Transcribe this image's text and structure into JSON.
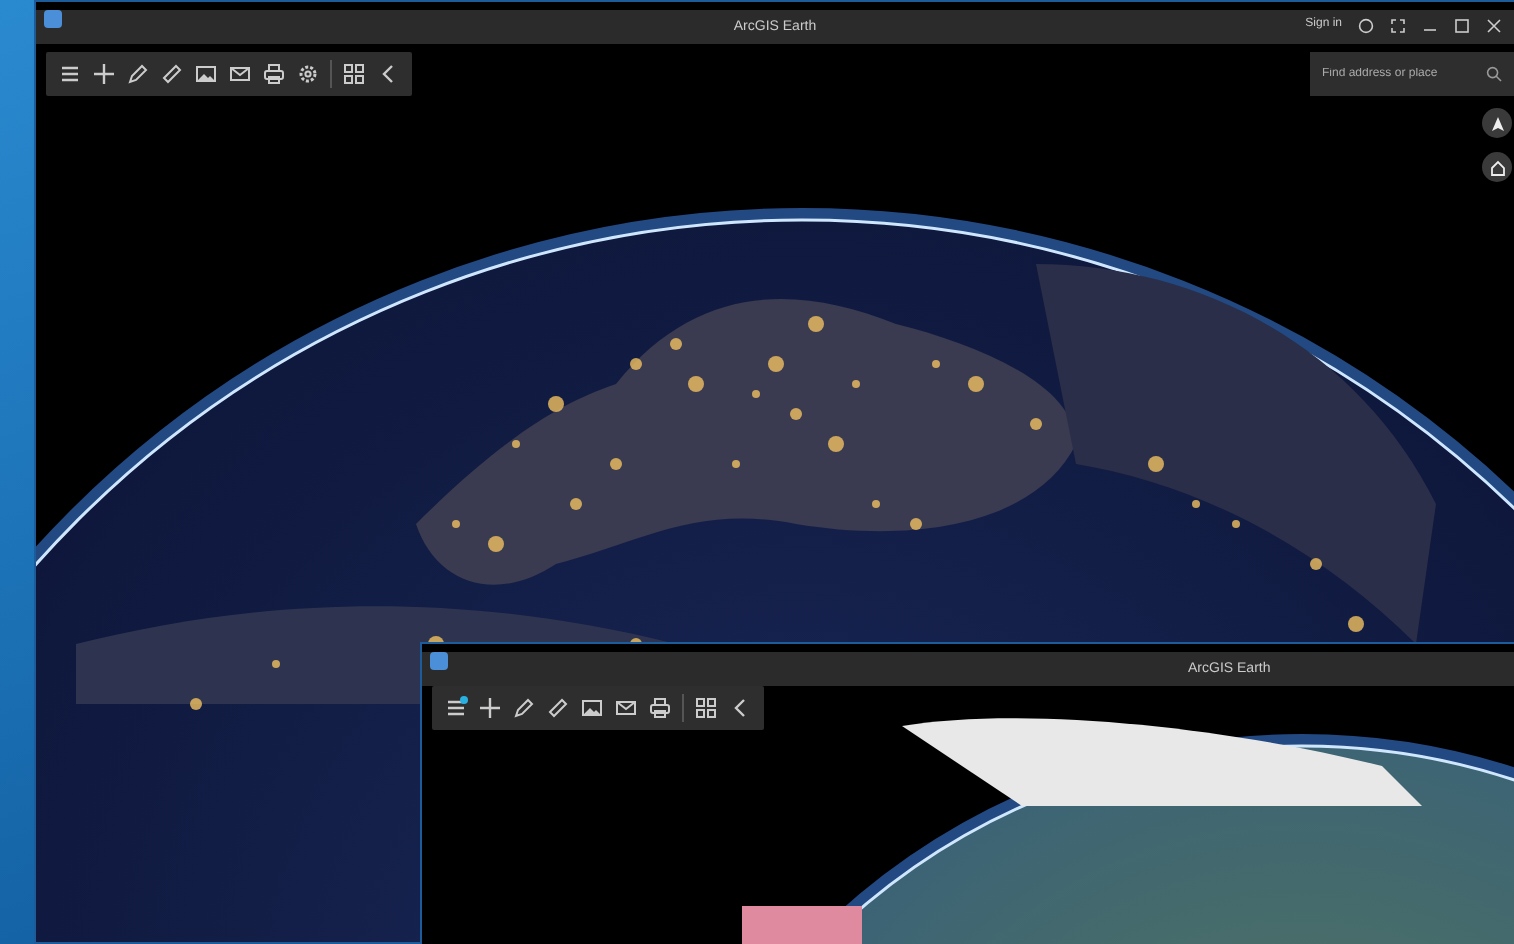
{
  "windows": [
    {
      "title": "ArcGIS Earth",
      "sign_in": "Sign in",
      "search": {
        "placeholder": "Find address or place"
      }
    },
    {
      "title": "ArcGIS Earth"
    }
  ]
}
